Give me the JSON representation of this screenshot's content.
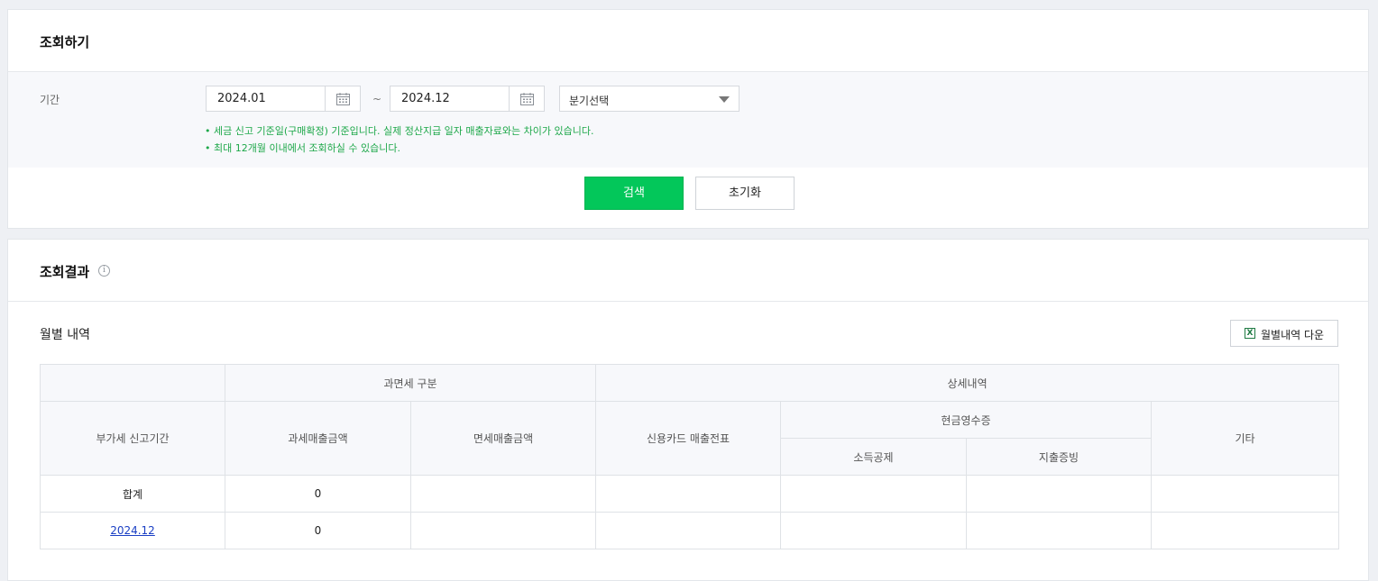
{
  "search": {
    "title": "조회하기",
    "period_label": "기간",
    "start_date": "2024.01",
    "tilde": "~",
    "end_date": "2024.12",
    "quarter_select": "분기선택",
    "notice_1": "• 세금 신고 기준일(구매확정) 기준입니다. 실제 정산지급 일자 매출자료와는 차이가 있습니다.",
    "notice_2": "• 최대 12개월 이내에서 조회하실 수 있습니다.",
    "search_button": "검색",
    "reset_button": "초기화"
  },
  "result": {
    "title": "조회결과",
    "info_glyph": "i",
    "sub_title": "월별 내역",
    "excel_icon_glyph": "X",
    "excel_button": "월별내역 다운",
    "table": {
      "h_taxtype": "과면세 구분",
      "h_detail": "상세내역",
      "h_period": "부가세 신고기간",
      "h_taxable": "과세매출금액",
      "h_exempt": "면세매출금액",
      "h_card": "신용카드 매출전표",
      "h_cash": "현금영수증",
      "h_other": "기타",
      "h_deduct": "소득공제",
      "h_proof": "지출증빙",
      "rows": [
        {
          "period": "합계",
          "taxable": "0"
        },
        {
          "period": "2024.12",
          "taxable": "0"
        }
      ]
    }
  },
  "colors": {
    "primary_green": "#03c75a",
    "notice_green": "#1ea84a",
    "link_blue": "#1a3fc4"
  }
}
